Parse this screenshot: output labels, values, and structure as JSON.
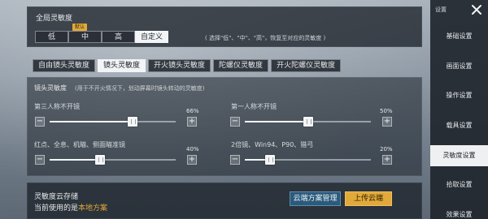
{
  "global": {
    "title": "全局灵敏度",
    "presets": [
      "低",
      "中",
      "高",
      "自定义"
    ],
    "default_badge": "默认",
    "selected": "自定义",
    "hint": "( 选择\"低\"、\"中\"、\"高\"，恢复至对应的灵敏度 )"
  },
  "tabs": [
    "自由镜头灵敏度",
    "镜头灵敏度",
    "开火镜头灵敏度",
    "陀螺仪灵敏度",
    "开火陀螺仪灵敏度"
  ],
  "active_tab": "镜头灵敏度",
  "main": {
    "section_title": "镜头灵敏度",
    "section_hint": "(用于不开火情况下，划动屏幕时镜头转动的灵敏度)",
    "sliders": [
      {
        "label": "第三人称不开镜",
        "percent_text": "66%",
        "value": 66
      },
      {
        "label": "第一人称不开镜",
        "percent_text": "50%",
        "value": 50
      },
      {
        "label": "红点、全息、机瞄、侧面瞄准镜",
        "percent_text": "40%",
        "value": 40
      },
      {
        "label": "2倍镜、Win94、P90、猎弓",
        "percent_text": "20%",
        "value": 20
      }
    ],
    "minus_symbol": "−",
    "plus_symbol": "+"
  },
  "cloud": {
    "title": "灵敏度云存储",
    "current_prefix": "当前使用的是",
    "current_scheme": "本地方案",
    "manage_label": "云端方案管理",
    "upload_label": "上传云端"
  },
  "sidebar": {
    "title": "设置",
    "items": [
      "基础设置",
      "画面设置",
      "操作设置",
      "载具设置",
      "灵敏度设置",
      "拾取设置",
      "效果设置"
    ],
    "active": "灵敏度设置"
  },
  "colors": {
    "accent": "#e2a93a",
    "panel": "#1c222a",
    "selected_light": "#f2f4f6"
  }
}
